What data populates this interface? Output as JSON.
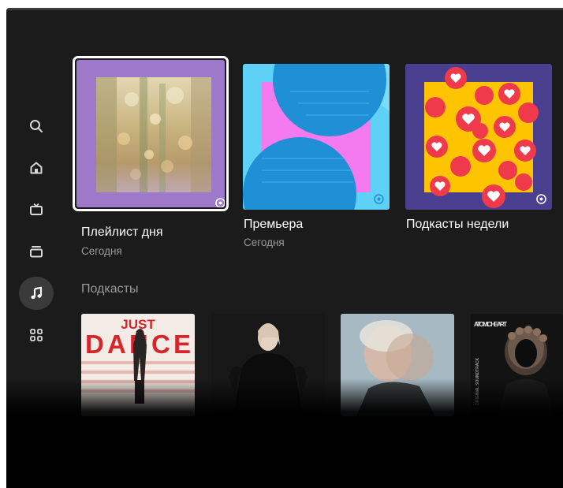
{
  "sidebar": {
    "items": [
      {
        "name": "search",
        "icon": "search-icon",
        "active": false
      },
      {
        "name": "home",
        "icon": "home-icon",
        "active": false
      },
      {
        "name": "tv",
        "icon": "tv-icon",
        "active": false
      },
      {
        "name": "collection",
        "icon": "collection-icon",
        "active": false
      },
      {
        "name": "music",
        "icon": "music-note-icon",
        "active": true
      },
      {
        "name": "apps",
        "icon": "apps-grid-icon",
        "active": false
      }
    ]
  },
  "featured": [
    {
      "title": "Плейлист дня",
      "subtitle": "Сегодня",
      "focused": true,
      "badge_icon": "music-service-badge-icon"
    },
    {
      "title": "Премьера",
      "subtitle": "Сегодня",
      "focused": false,
      "badge_icon": "music-service-badge-icon"
    },
    {
      "title": "Подкасты недели",
      "subtitle": "",
      "focused": false,
      "badge_icon": "music-service-badge-icon"
    }
  ],
  "podcasts": {
    "title": "Подкасты",
    "items": [
      {
        "cover_text_1": "JUST",
        "cover_text_2": "DANCE"
      },
      {
        "cover_text_1": "",
        "cover_text_2": ""
      },
      {
        "cover_text_1": "",
        "cover_text_2": ""
      },
      {
        "cover_text_1": "ATOMIC HEART",
        "cover_text_2": "ORIGINAL SOUNDTRACK"
      }
    ]
  },
  "colors": {
    "background": "#1b1b1b",
    "accent_purple": "#9f79c9",
    "accent_cyan": "#5fd1f7",
    "accent_navy": "#4a3f8f"
  }
}
